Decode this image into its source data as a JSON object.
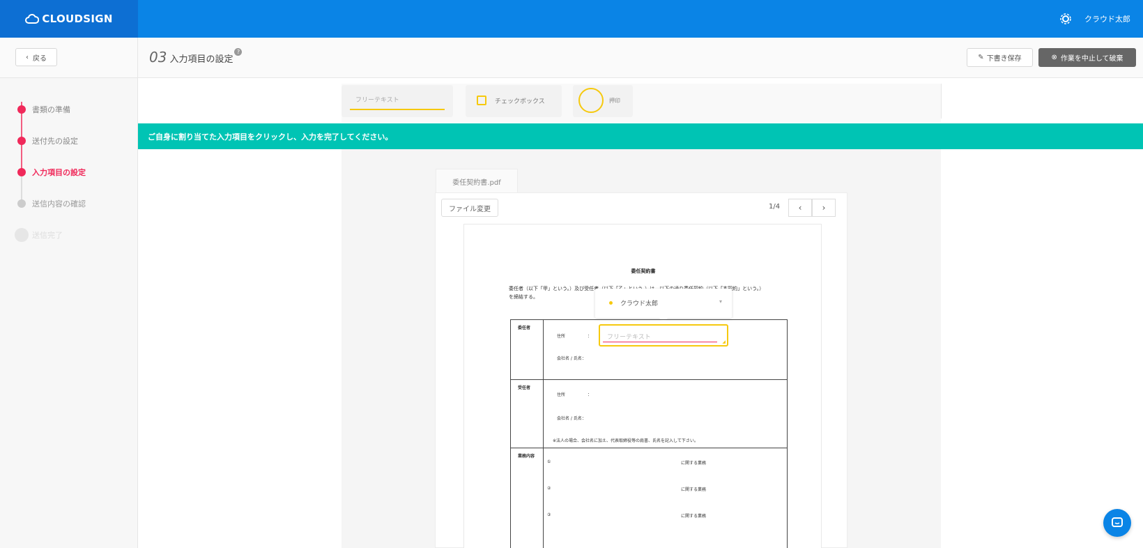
{
  "brand": {
    "name": "CLOUDSIGN"
  },
  "header": {
    "user_name": "クラウド太郎"
  },
  "subheader": {
    "back_label": "戻る",
    "step_number": "03",
    "step_title": "入力項目の設定",
    "help_mark": "?",
    "save_draft_label": "下書き保存",
    "discard_label": "作業を中止して破棄"
  },
  "sidebar": {
    "steps": [
      {
        "label": "書類の準備",
        "state": "done"
      },
      {
        "label": "送付先の設定",
        "state": "done"
      },
      {
        "label": "入力項目の設定",
        "state": "active"
      },
      {
        "label": "送信内容の確認",
        "state": "todo"
      },
      {
        "label": "送信完了",
        "state": "future"
      }
    ]
  },
  "toolbox": {
    "free_text_placeholder": "フリーテキスト",
    "checkbox_label": "チェックボックス",
    "stamp_label": "押印"
  },
  "banner": {
    "message": "ご自身に割り当てた入力項目をクリックし、入力を完了してください。"
  },
  "document": {
    "file_name": "委任契約書.pdf",
    "change_file_label": "ファイル変更",
    "page_indicator": "1/4",
    "prev_icon": "‹",
    "next_icon": "›",
    "title": "委任契約書",
    "intro": "委任者（以下「甲」という。）及び受任者（以下「乙」という。）は、以下の通り委任契約（以下「本契約」という。）を締結する。",
    "assignee": "クラウド太郎",
    "assignee_caret": "▾",
    "rows": [
      {
        "label": "委任者",
        "address_label": "住所",
        "address_colon": "：",
        "name_label": "会社名 / 氏名："
      },
      {
        "label": "受任者",
        "address_label": "住所",
        "address_colon": "：",
        "name_label": "会社名 / 氏名：",
        "note": "※法人の場合、会社名に加え、代表取締役等の肩書、氏名を記入して下さい。"
      },
      {
        "label": "業務内容",
        "items": [
          {
            "num": "①",
            "text": "に関する業務"
          },
          {
            "num": "②",
            "text": "に関する業務"
          },
          {
            "num": "③",
            "text": "に関する業務"
          }
        ]
      }
    ],
    "field_placeholder": "フリーテキスト",
    "field_corner_mark": "◢"
  },
  "colors": {
    "header_blue": "#0a84e6",
    "brand_blue": "#0d6fd3",
    "accent_pink": "#f0295a",
    "banner_teal": "#00c4b4",
    "field_yellow": "#f6c90e"
  }
}
